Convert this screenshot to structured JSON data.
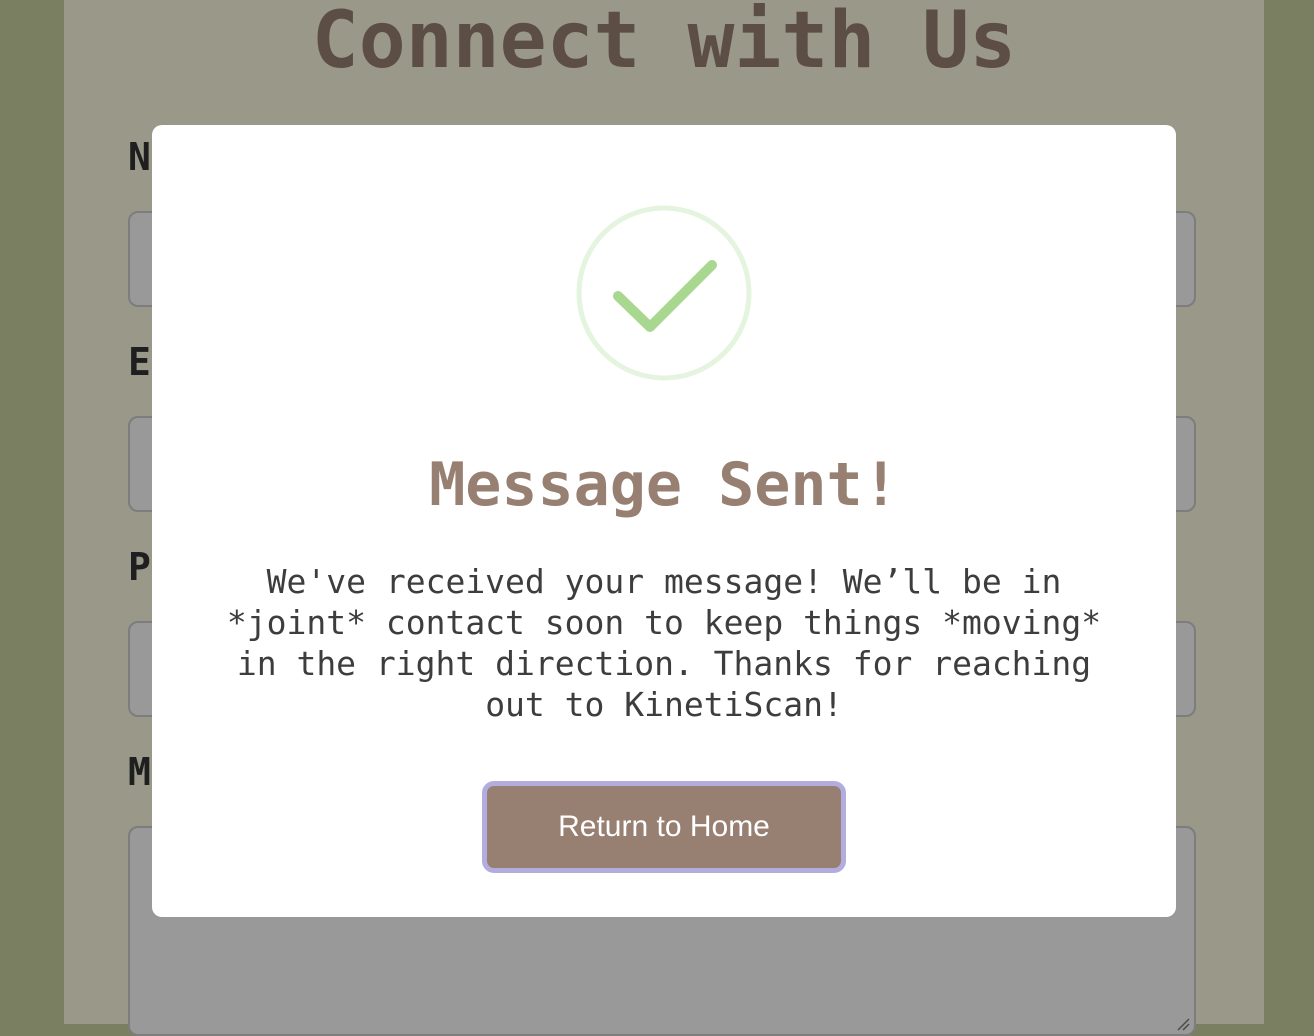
{
  "form": {
    "title": "Connect with Us",
    "fields": [
      {
        "label": "N"
      },
      {
        "label": "E"
      },
      {
        "label": "P"
      },
      {
        "label": "M"
      }
    ]
  },
  "modal": {
    "icon": "check-circle-icon",
    "title": "Message Sent!",
    "message": "We've received your message! We’ll be in *joint* contact soon to keep things *moving* in the right direction. Thanks for reaching out to KinetiScan!",
    "button_label": "Return to Home"
  },
  "colors": {
    "page_background": "#7b7f62",
    "form_background": "#999889",
    "accent": "#977f72",
    "button_focus_ring": "#b3addf",
    "success_check": "#a8d88f",
    "success_circle": "#e5f4df"
  }
}
